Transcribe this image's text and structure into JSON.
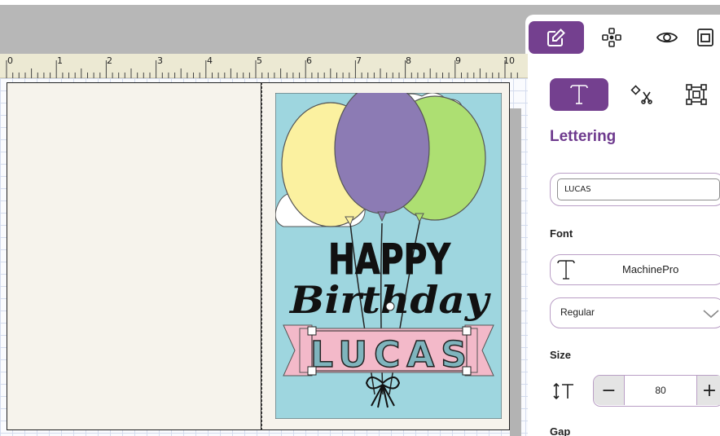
{
  "toolbar": {
    "tools": [
      {
        "icon": "edit-icon",
        "active": true
      },
      {
        "icon": "arrange-icon",
        "active": false
      },
      {
        "icon": "eye-icon",
        "active": false
      },
      {
        "icon": "layers-icon",
        "active": false
      }
    ]
  },
  "ruler": {
    "marks": [
      "0",
      "1",
      "2",
      "3",
      "4",
      "5",
      "6",
      "7",
      "8",
      "9",
      "10"
    ]
  },
  "canvas": {
    "design": {
      "line1": "HAPPY",
      "line2": "Birthday",
      "banner_text": "LUCAS"
    }
  },
  "panel": {
    "tabs": [
      {
        "icon": "text-tab-icon",
        "active": true
      },
      {
        "icon": "weld-tab-icon",
        "active": false
      },
      {
        "icon": "transform-tab-icon",
        "active": false
      }
    ],
    "title": "Lettering",
    "text_value": "LUCAS",
    "font_label": "Font",
    "font_name": "MachinePro",
    "font_style": "Regular",
    "size_label": "Size",
    "size_value": "80",
    "minus_glyph": "−",
    "plus_glyph": "+",
    "gap_label": "Gap"
  },
  "colors": {
    "accent": "#74408f",
    "card_background": "#9ed6df",
    "balloon_yellow": "#fbf1a0",
    "balloon_purple": "#8c7bb4",
    "balloon_green": "#addf72",
    "banner_pink": "#f3b9c9",
    "banner_letters": "#7fb4bd"
  }
}
